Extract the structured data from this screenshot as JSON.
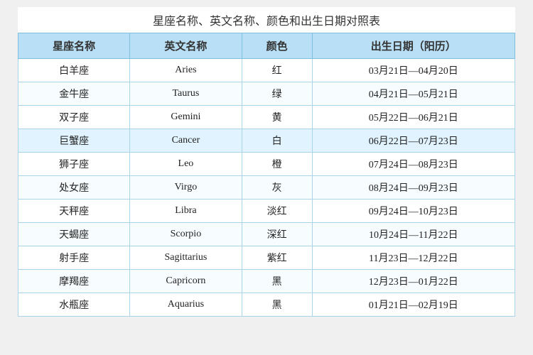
{
  "title": "星座名称、英文名称、颜色和出生日期对照表",
  "headers": [
    "星座名称",
    "英文名称",
    "颜色",
    "出生日期（阳历）"
  ],
  "rows": [
    {
      "chinese": "白羊座",
      "english": "Aries",
      "color": "红",
      "dates": "03月21日—04月20日",
      "highlight": false
    },
    {
      "chinese": "金牛座",
      "english": "Taurus",
      "color": "绿",
      "dates": "04月21日—05月21日",
      "highlight": false
    },
    {
      "chinese": "双子座",
      "english": "Gemini",
      "color": "黄",
      "dates": "05月22日—06月21日",
      "highlight": false
    },
    {
      "chinese": "巨蟹座",
      "english": "Cancer",
      "color": "白",
      "dates": "06月22日—07月23日",
      "highlight": true
    },
    {
      "chinese": "狮子座",
      "english": "Leo",
      "color": "橙",
      "dates": "07月24日—08月23日",
      "highlight": false
    },
    {
      "chinese": "处女座",
      "english": "Virgo",
      "color": "灰",
      "dates": "08月24日—09月23日",
      "highlight": false
    },
    {
      "chinese": "天秤座",
      "english": "Libra",
      "color": "淡红",
      "dates": "09月24日—10月23日",
      "highlight": false
    },
    {
      "chinese": "天蝎座",
      "english": "Scorpio",
      "color": "深红",
      "dates": "10月24日—11月22日",
      "highlight": false
    },
    {
      "chinese": "射手座",
      "english": "Sagittarius",
      "color": "紫红",
      "dates": "11月23日—12月22日",
      "highlight": false
    },
    {
      "chinese": "摩羯座",
      "english": "Capricorn",
      "color": "黑",
      "dates": "12月23日—01月22日",
      "highlight": false
    },
    {
      "chinese": "水瓶座",
      "english": "Aquarius",
      "color": "黑",
      "dates": "01月21日—02月19日",
      "highlight": false
    }
  ]
}
